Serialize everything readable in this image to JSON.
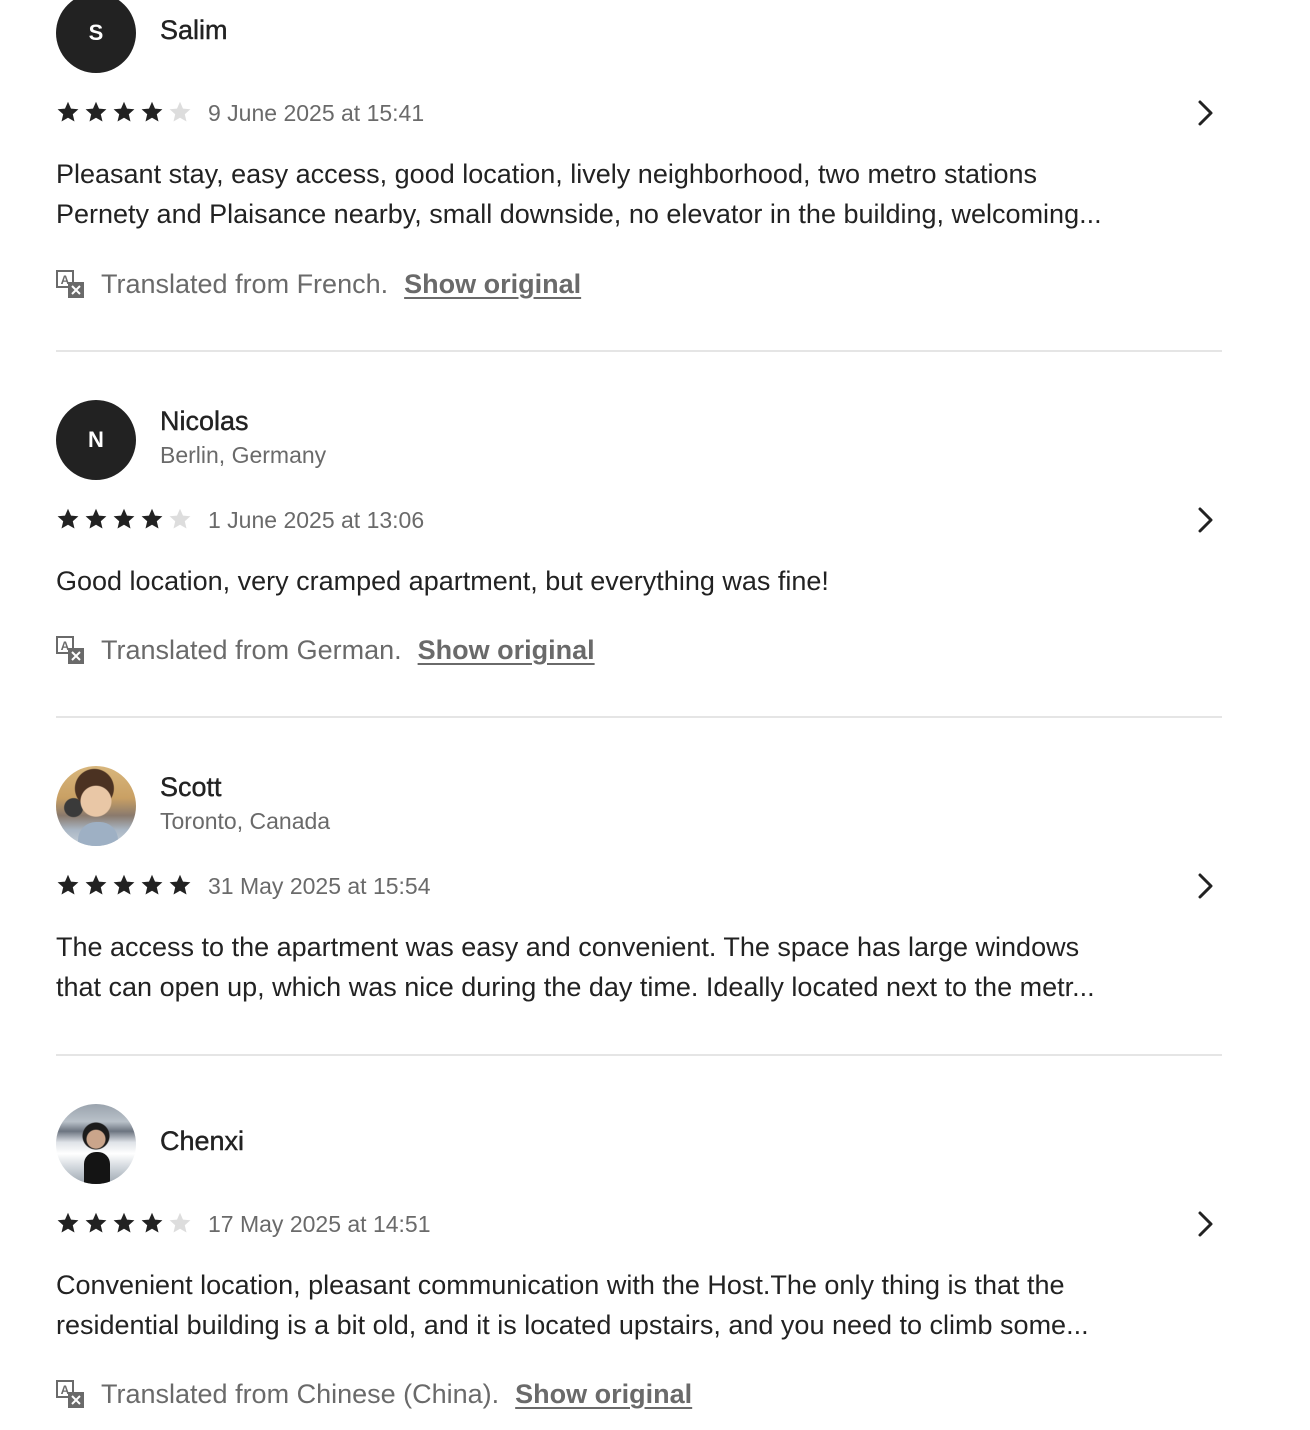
{
  "reviews": [
    {
      "avatar_initial": "S",
      "avatar_type": "initial",
      "name": "Salim",
      "location": "",
      "rating": 4,
      "date": "9 June 2025 at 15:41",
      "text_lines": [
        "Pleasant stay, easy access, good location, lively neighborhood, two metro stations",
        "Pernety and Plaisance nearby, small downside, no elevator in the building, welcoming..."
      ],
      "translation_note": "Translated from French.",
      "show_original_label": "Show original"
    },
    {
      "avatar_initial": "N",
      "avatar_type": "initial",
      "name": "Nicolas",
      "location": "Berlin, Germany",
      "rating": 4,
      "date": "1 June 2025 at 13:06",
      "text_lines": [
        "Good location, very cramped apartment, but everything was fine!"
      ],
      "translation_note": "Translated from German.",
      "show_original_label": "Show original"
    },
    {
      "avatar_initial": "",
      "avatar_type": "photo",
      "name": "Scott",
      "location": "Toronto, Canada",
      "rating": 5,
      "date": "31 May 2025 at 15:54",
      "text_lines": [
        "The access to the apartment was easy and convenient. The space has large windows",
        "that can open up, which was nice during the day time. Ideally located next to the metr..."
      ],
      "translation_note": "",
      "show_original_label": ""
    },
    {
      "avatar_initial": "",
      "avatar_type": "photo",
      "name": "Chenxi",
      "location": "",
      "rating": 4,
      "date": "17 May 2025 at 14:51",
      "text_lines": [
        "Convenient location, pleasant communication with the Host.The only thing is that the",
        "residential building is a bit old, and it is located upstairs, and you need to climb some..."
      ],
      "translation_note": "Translated from Chinese (China).",
      "show_original_label": "Show original"
    }
  ],
  "icons": {
    "star_filled": "star-icon",
    "star_empty": "star-empty-icon",
    "chevron": "chevron-right-icon",
    "translate": "translate-icon"
  },
  "colors": {
    "text_primary": "#222222",
    "text_secondary": "#6a6a6a",
    "star_filled": "#222222",
    "star_empty": "#dddddd",
    "divider": "#e5e5e5",
    "avatar_bg": "#222222"
  }
}
